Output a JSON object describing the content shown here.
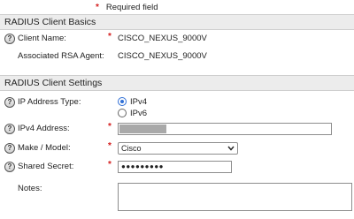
{
  "required_legend": {
    "marker": "*",
    "text": "Required field"
  },
  "sections": {
    "basics": {
      "title": "RADIUS Client Basics"
    },
    "settings": {
      "title": "RADIUS Client Settings"
    }
  },
  "basics": {
    "client_name": {
      "label": "Client Name:",
      "value": "CISCO_NEXUS_9000V",
      "required": true
    },
    "rsa_agent": {
      "label": "Associated RSA Agent:",
      "value": "CISCO_NEXUS_9000V"
    }
  },
  "settings": {
    "ip_type": {
      "label": "IP Address Type:",
      "options": [
        "IPv4",
        "IPv6"
      ],
      "selected": "IPv4"
    },
    "ipv4": {
      "label": "IPv4 Address:",
      "value": ""
    },
    "make_model": {
      "label": "Make / Model:",
      "value": "Cisco"
    },
    "secret": {
      "label": "Shared Secret:",
      "value": "●●●●●●●●●"
    },
    "notes": {
      "label": "Notes:",
      "value": ""
    }
  },
  "help_icon_glyph": "?"
}
